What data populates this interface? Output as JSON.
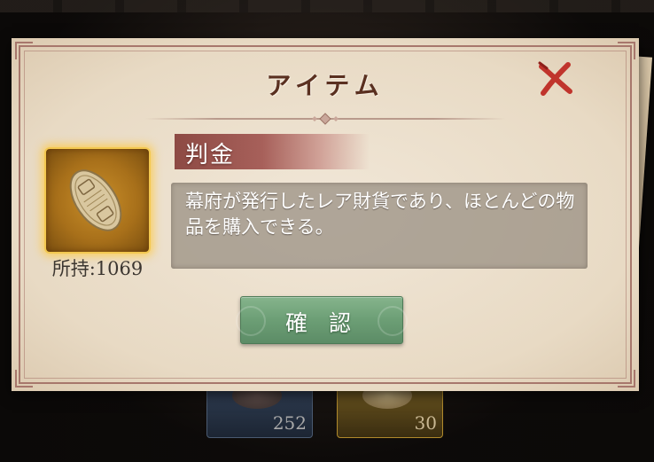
{
  "dialog": {
    "title": "アイテム",
    "close_icon": "close-x-icon",
    "item": {
      "icon": "koban-gold-coin-icon",
      "name": "判金",
      "owned_label": "所持:1069",
      "description": "幕府が発行したレア財貨であり、ほとんどの物品を購入できる。"
    },
    "confirm_label": "確 認"
  },
  "background_cards": [
    {
      "count": "252"
    },
    {
      "count": "30"
    }
  ],
  "colors": {
    "title": "#5a3020",
    "close": "#c0342c",
    "banner": "#a7605a",
    "confirm": "#6c9e75",
    "item_glow": "#f3c850"
  }
}
